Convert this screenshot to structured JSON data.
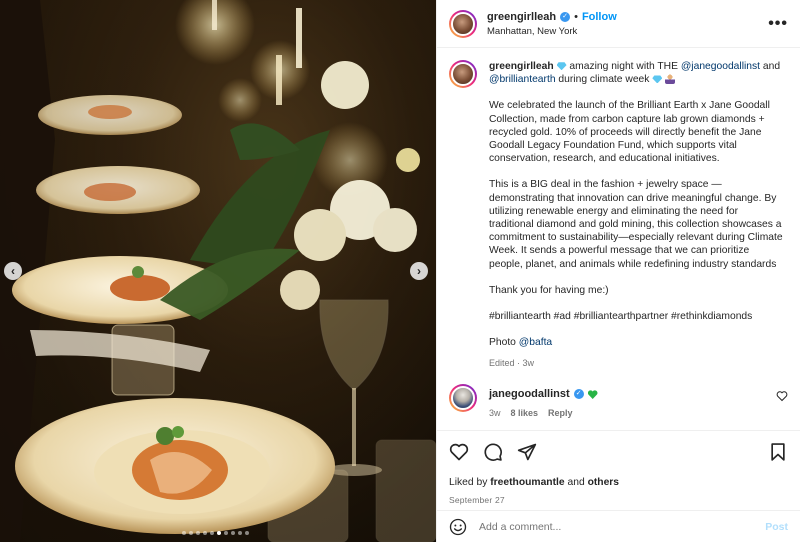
{
  "post": {
    "author": "greengirlleah",
    "separator": "•",
    "follow_label": "Follow",
    "location": "Manhattan, New York",
    "more_label": "•••"
  },
  "caption": {
    "author": "greengirlleah",
    "line1_pre": "amazing night with THE",
    "mention1": "@janegoodallinst",
    "line1_and": "and",
    "mention2": "@brilliantearth",
    "line1_post": "during climate week",
    "para1": "We celebrated the launch of the Brilliant Earth x Jane Goodall Collection, made from carbon capture lab grown diamonds + recycled gold. 10% of proceeds will directly benefit the Jane Goodall Legacy Foundation Fund, which supports vital conservation, research, and educational initiatives.",
    "para2": "This is a BIG deal in the fashion + jewelry space — demonstrating that innovation can drive meaningful change. By utilizing renewable energy and eliminating the need for traditional diamond and gold mining, this collection showcases a commitment to sustainability—especially relevant during Climate Week. It sends a powerful message that we can prioritize people, planet, and animals while redefining industry standards",
    "para3": "Thank you for having me:)",
    "hashtags": "#brilliantearth #ad #brilliantearthpartner #rethinkdiamonds",
    "photo_label": "Photo",
    "photo_credit": "@bafta",
    "edited_label": "Edited",
    "edited_age": "3w"
  },
  "reply": {
    "author": "janegoodallinst",
    "age": "3w",
    "likes": "8 likes",
    "reply_label": "Reply"
  },
  "footer": {
    "liked_by_prefix": "Liked by",
    "liked_by_user": "freethoumantle",
    "liked_by_and": "and",
    "liked_by_others": "others",
    "date": "September 27",
    "comment_placeholder": "Add a comment...",
    "post_label": "Post"
  },
  "media": {
    "prev_glyph": "‹",
    "next_glyph": "›",
    "carousel_dots": 10,
    "active_dot": 5
  },
  "colors": {
    "link": "#00376b",
    "follow": "#0095f6",
    "verified": "#3897f0",
    "green_heart": "#28b446"
  }
}
